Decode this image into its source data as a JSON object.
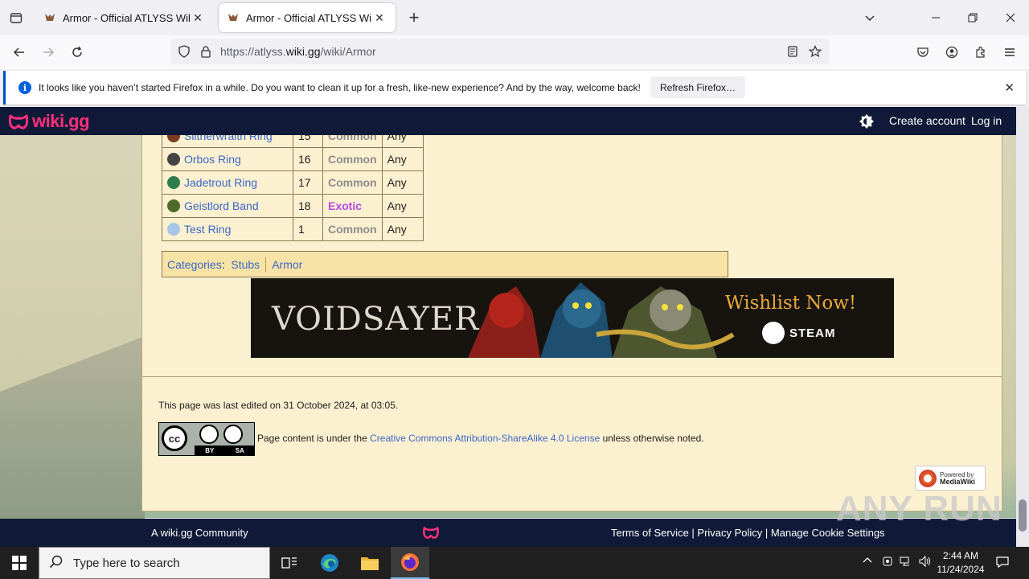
{
  "browser": {
    "tabs": [
      {
        "title": "Armor - Official ATLYSS Wiki",
        "active": false
      },
      {
        "title": "Armor - Official ATLYSS Wiki",
        "active": true
      }
    ],
    "url_prefix": "https://atlyss.",
    "url_domain": "wiki.gg",
    "url_path": "/wiki/Armor",
    "notification": {
      "message": "It looks like you haven’t started Firefox in a while. Do you want to clean it up for a fresh, like-new experience? And by the way, welcome back!",
      "button": "Refresh Firefox…"
    }
  },
  "wiki": {
    "logo_text": "wiki.gg",
    "create_account": "Create account",
    "log_in": "Log in",
    "rings": [
      {
        "name": "Slitherwraith Ring",
        "level": "15",
        "rarity": "Common",
        "class": "Any",
        "icon_color": "#7a3b20"
      },
      {
        "name": "Orbos Ring",
        "level": "16",
        "rarity": "Common",
        "class": "Any",
        "icon_color": "#444444"
      },
      {
        "name": "Jadetrout Ring",
        "level": "17",
        "rarity": "Common",
        "class": "Any",
        "icon_color": "#2e7d4f"
      },
      {
        "name": "Geistlord Band",
        "level": "18",
        "rarity": "Exotic",
        "class": "Any",
        "icon_color": "#4e6b2a"
      },
      {
        "name": "Test Ring",
        "level": "1",
        "rarity": "Common",
        "class": "Any",
        "icon_color": "#a9c6e8"
      }
    ],
    "categories_label": "Categories",
    "categories": [
      "Stubs",
      "Armor"
    ],
    "banner": {
      "title": "VOIDSAYER",
      "cta": "Wishlist Now!",
      "store": "STEAM"
    },
    "last_edited": "This page was last edited on 31 October 2024, at 03:05.",
    "licence_prefix": "Page content is under the ",
    "licence_link": "Creative Commons Attribution-ShareAlike 4.0 License",
    "licence_suffix": " unless otherwise noted.",
    "cc_by": "BY",
    "cc_sa": "SA",
    "cc_mark": "cc",
    "powered_by": "Powered by",
    "mediawiki": "MediaWiki",
    "footer_left": "A wiki.gg Community",
    "footer_right": "Terms of Service | Privacy Policy | Manage Cookie Settings"
  },
  "watermark": "ANY RUN",
  "taskbar": {
    "search_placeholder": "Type here to search",
    "time": "2:44 AM",
    "date": "11/24/2024"
  },
  "colors": {
    "accent_pink": "#ff2f7a",
    "wiki_navy": "#101a38",
    "link": "#3b67c9",
    "exotic": "#b54be4",
    "common": "#8d8d8d"
  }
}
